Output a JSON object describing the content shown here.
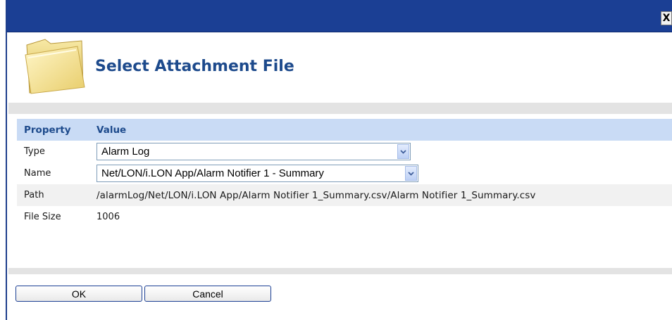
{
  "window": {
    "close_glyph": "X"
  },
  "header": {
    "title": "Select Attachment File",
    "icon": "folder-icon"
  },
  "table": {
    "headers": [
      "Property",
      "Value"
    ],
    "rows": [
      {
        "property": "Type",
        "value": "Alarm Log"
      },
      {
        "property": "Name",
        "value": "Net/LON/i.LON App/Alarm Notifier 1 - Summary"
      },
      {
        "property": "Path",
        "value": "/alarmLog/Net/LON/i.LON App/Alarm Notifier 1_Summary.csv/Alarm Notifier 1_Summary.csv"
      },
      {
        "property": "File Size",
        "value": "1006"
      }
    ]
  },
  "buttons": {
    "ok": "OK",
    "cancel": "Cancel"
  },
  "colors": {
    "titlebar": "#1b3f94",
    "header_text": "#1d4a8c",
    "table_header_bg": "#c9dbf5"
  }
}
